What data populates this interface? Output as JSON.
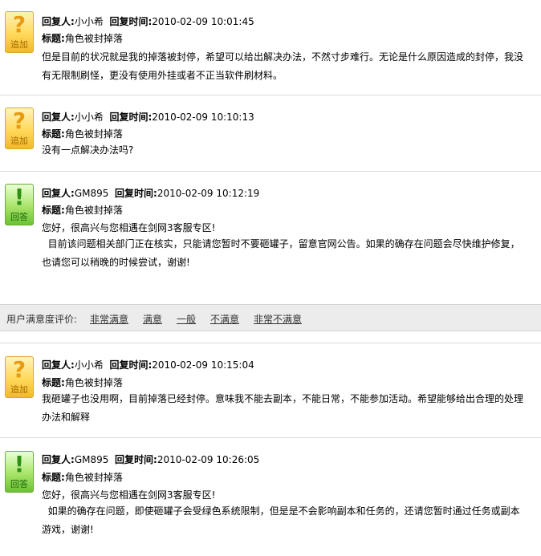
{
  "labels": {
    "replier": "回复人:",
    "reply_time": "回复时间:",
    "title": "标题:"
  },
  "entries": [
    {
      "kind": "ask",
      "glyph": "?",
      "badge": "追加",
      "replier": "小小希",
      "time": "2010-02-09 10:01:45",
      "title": "角色被封掉落",
      "content": "但是目前的状况就是我的掉落被封停，希望可以给出解决办法，不然寸步难行。无论是什么原因造成的封停，我没有无限制刷怪，更没有使用外挂或者不正当软件刷材料。"
    },
    {
      "kind": "ask",
      "glyph": "?",
      "badge": "追加",
      "replier": "小小希",
      "time": "2010-02-09 10:10:13",
      "title": "角色被封掉落",
      "content": "没有一点解决办法吗?"
    },
    {
      "kind": "ans",
      "glyph": "!",
      "badge": "回答",
      "replier": "GM895",
      "time": "2010-02-09 10:12:19",
      "title": "角色被封掉落",
      "greeting": "您好，很高兴与您相遇在剑网3客服专区!",
      "content": "  目前该问题相关部门正在核实，只能请您暂时不要砸罐子，留意官网公告。如果的确存在问题会尽快维护修复，也请您可以稍晚的时候尝试，谢谢!"
    },
    {
      "kind": "ask",
      "glyph": "?",
      "badge": "追加",
      "replier": "小小希",
      "time": "2010-02-09 10:15:04",
      "title": "角色被封掉落",
      "content": "我砸罐子也没用啊，目前掉落已经封停。意味我不能去副本，不能日常，不能参加活动。希望能够给出合理的处理办法和解释"
    },
    {
      "kind": "ans",
      "glyph": "!",
      "badge": "回答",
      "replier": "GM895",
      "time": "2010-02-09 10:26:05",
      "title": "角色被封掉落",
      "greeting": "您好，很高兴与您相遇在剑网3客服专区!",
      "content": "  如果的确存在问题，即使砸罐子会受绿色系统限制，但是是不会影响副本和任务的，还请您暂时通过任务或副本游戏，谢谢!"
    }
  ],
  "survey": {
    "label": "用户满意度评价:",
    "options": [
      "非常满意",
      "满意",
      "一般",
      "不满意",
      "非常不满意"
    ]
  }
}
